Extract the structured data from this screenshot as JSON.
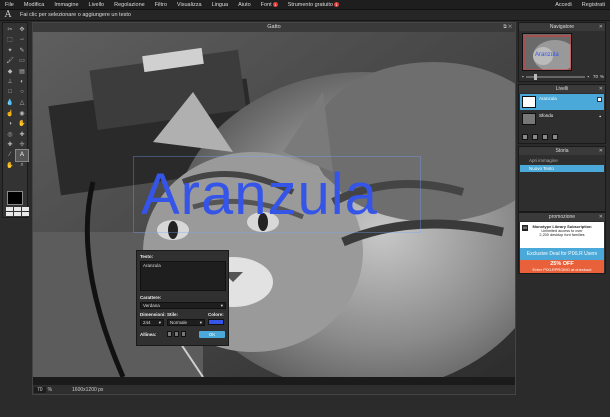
{
  "menubar": {
    "items": [
      {
        "label": "File"
      },
      {
        "label": "Modifica"
      },
      {
        "label": "Immagine"
      },
      {
        "label": "Livello"
      },
      {
        "label": "Regolazione"
      },
      {
        "label": "Filtro"
      },
      {
        "label": "Visualizza"
      },
      {
        "label": "Lingua"
      },
      {
        "label": "Aiuto"
      },
      {
        "label": "Font",
        "badge": "1"
      },
      {
        "label": "Strumento gratuito",
        "badge": "1"
      }
    ],
    "right": [
      "Accedi",
      "Registrati"
    ]
  },
  "hintbar": {
    "hint": "Fai clic per selezionare o aggiungere un testo"
  },
  "canvas": {
    "title": "Gatto",
    "overlay_text": "Aranzula",
    "overlay_color": "#3555e8",
    "zoom": "70",
    "zoom_unit": "%",
    "dimensions": "1600x1200 px"
  },
  "text_dialog": {
    "text_label": "Testo:",
    "text_value": "Aranzula",
    "font_label": "Carattere:",
    "font_value": "Verdana",
    "size_label": "Dimensioni:",
    "size_value": "244",
    "style_label": "Stile:",
    "style_value": "Normale",
    "color_label": "Colore:",
    "align_label": "Allinea:",
    "ok_label": "OK"
  },
  "navigator": {
    "title": "Navigatore",
    "zoom": "70",
    "zoom_unit": "%"
  },
  "layers": {
    "title": "Livelli",
    "items": [
      {
        "name": "Aranzula",
        "selected": true
      },
      {
        "name": "Sfondo",
        "selected": false
      }
    ]
  },
  "history": {
    "title": "Storia",
    "items": [
      {
        "name": "Apri immagine"
      },
      {
        "name": "Nuovo Testo",
        "selected": true
      }
    ]
  },
  "promo": {
    "title": "promozione",
    "brand": "Monotype Library Subscription",
    "line1": "Unlimited access to over",
    "line2": "2,200 desktop font families",
    "deal": "Exclusive Deal for PIXLR Users",
    "discount": "25% OFF",
    "code": "Enter PIXLRPROMO at checkout"
  },
  "colors": {
    "accent": "#4aa9d8",
    "text_color": "#3555e8",
    "promo_orange": "#e8613b"
  }
}
